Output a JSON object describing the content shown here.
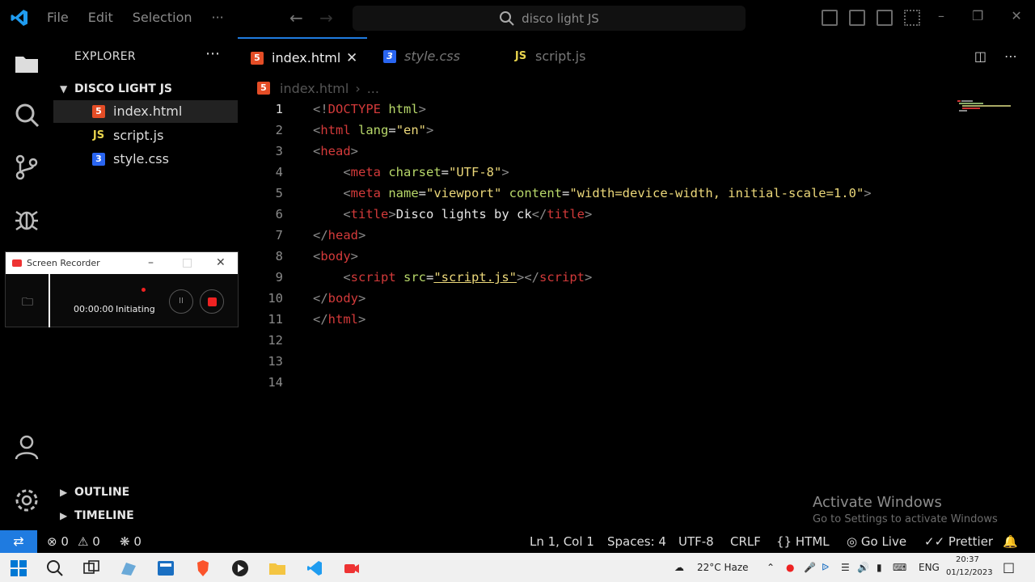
{
  "titlebar": {
    "menu": [
      "File",
      "Edit",
      "Selection",
      "···"
    ],
    "search_text": "disco light JS"
  },
  "sidebar": {
    "title": "EXPLORER",
    "folder": "DISCO LIGHT JS",
    "files": [
      {
        "name": "index.html",
        "icon": "html5-icon"
      },
      {
        "name": "script.js",
        "icon": "js-icon"
      },
      {
        "name": "style.css",
        "icon": "css3-icon"
      }
    ],
    "outline": "OUTLINE",
    "timeline": "TIMELINE"
  },
  "recorder": {
    "title": "Screen Recorder",
    "time": "00:00:00",
    "status": "Initiating"
  },
  "tabs": [
    {
      "label": "index.html",
      "state": "active"
    },
    {
      "label": "style.css",
      "state": "preview"
    },
    {
      "label": "script.js",
      "state": "inactive"
    }
  ],
  "breadcrumb": {
    "file": "index.html",
    "rest": "..."
  },
  "code_lines": [
    {
      "n": "1"
    },
    {
      "n": "2"
    },
    {
      "n": "3"
    },
    {
      "n": "4"
    },
    {
      "n": "5"
    },
    {
      "n": "6"
    },
    {
      "n": "7"
    },
    {
      "n": "8"
    },
    {
      "n": "9"
    },
    {
      "n": "10"
    },
    {
      "n": "11"
    },
    {
      "n": "12"
    },
    {
      "n": "13"
    },
    {
      "n": "14"
    }
  ],
  "code": {
    "l1": {
      "a": "<!",
      "b": "DOCTYPE",
      "c": " html",
      "d": ">"
    },
    "l2": {
      "a": "<",
      "b": "html",
      "c": " lang",
      "d": "=",
      "e": "\"en\"",
      "f": ">"
    },
    "l3": {
      "a": "<",
      "b": "head",
      "c": ">"
    },
    "l4": {
      "a": "    <",
      "b": "meta",
      "c": " charset",
      "d": "=",
      "e": "\"UTF-8\"",
      "f": ">"
    },
    "l5": {
      "a": "    <",
      "b": "meta",
      "c": " name",
      "d": "=",
      "e": "\"viewport\"",
      "f": " content",
      "g": "=",
      "h": "\"width=device-width, initial-scale=1.0\"",
      "i": ">"
    },
    "l6": {
      "a": "    <",
      "b": "title",
      "c": ">",
      "d": "Disco lights by ck",
      "e": "</",
      "f": "title",
      "g": ">"
    },
    "l7": {
      "a": "</",
      "b": "head",
      "c": ">"
    },
    "l8": {
      "a": "<",
      "b": "body",
      "c": ">"
    },
    "l9": {
      "a": "    <",
      "b": "script",
      "c": " src",
      "d": "=",
      "e": "\"script.js\"",
      "f": "></",
      "g": "script",
      "h": ">"
    },
    "l10": {
      "a": "</",
      "b": "body",
      "c": ">"
    },
    "l11": {
      "a": "</",
      "b": "html",
      "c": ">"
    }
  },
  "watermark": {
    "title": "Activate Windows",
    "subtitle": "Go to Settings to activate Windows"
  },
  "statusbar": {
    "errors": "0",
    "warnings": "0",
    "ports": "0",
    "position": "Ln 1, Col 1",
    "spaces": "Spaces: 4",
    "encoding": "UTF-8",
    "eol": "CRLF",
    "language": "HTML",
    "golive": "Go Live",
    "prettier": "Prettier"
  },
  "taskbar": {
    "weather": "22°C  Haze",
    "lang": "ENG",
    "time": "20:37",
    "date": "01/12/2023"
  },
  "colors": {
    "accent": "#1f7be0",
    "tag": "#d33a3a",
    "attr": "#b8d86a",
    "string": "#ecd87a"
  }
}
